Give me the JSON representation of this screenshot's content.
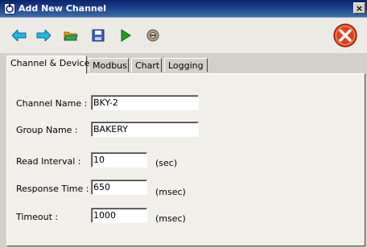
{
  "window": {
    "title": "Add New Channel",
    "close_glyph": "×"
  },
  "toolbar": {
    "buttons": [
      {
        "name": "back-arrow-icon"
      },
      {
        "name": "forward-arrow-icon"
      },
      {
        "name": "open-folder-icon"
      },
      {
        "name": "save-disk-icon"
      },
      {
        "name": "play-icon"
      },
      {
        "name": "tools-icon"
      }
    ],
    "exit_icon": "exit-icon"
  },
  "tabs": [
    {
      "label": "Channel & Device",
      "active": true
    },
    {
      "label": "Modbus",
      "active": false
    },
    {
      "label": "Chart",
      "active": false
    },
    {
      "label": "Logging",
      "active": false
    }
  ],
  "form": {
    "channel_name": {
      "label": "Channel Name  :",
      "value": "BKY-2"
    },
    "group_name": {
      "label": "Group Name   :",
      "value": "BAKERY"
    },
    "read_interval": {
      "label": "Read Interval  :",
      "value": "10",
      "unit": "(sec)"
    },
    "response_time": {
      "label": "Response Time :",
      "value": "650",
      "unit": "(msec)"
    },
    "timeout": {
      "label": "Timeout         :",
      "value": "1000",
      "unit": "(msec)"
    }
  },
  "colors": {
    "titlebar": "#0a246a",
    "accent_green": "#1aa01a",
    "exit_red": "#e0401a"
  }
}
